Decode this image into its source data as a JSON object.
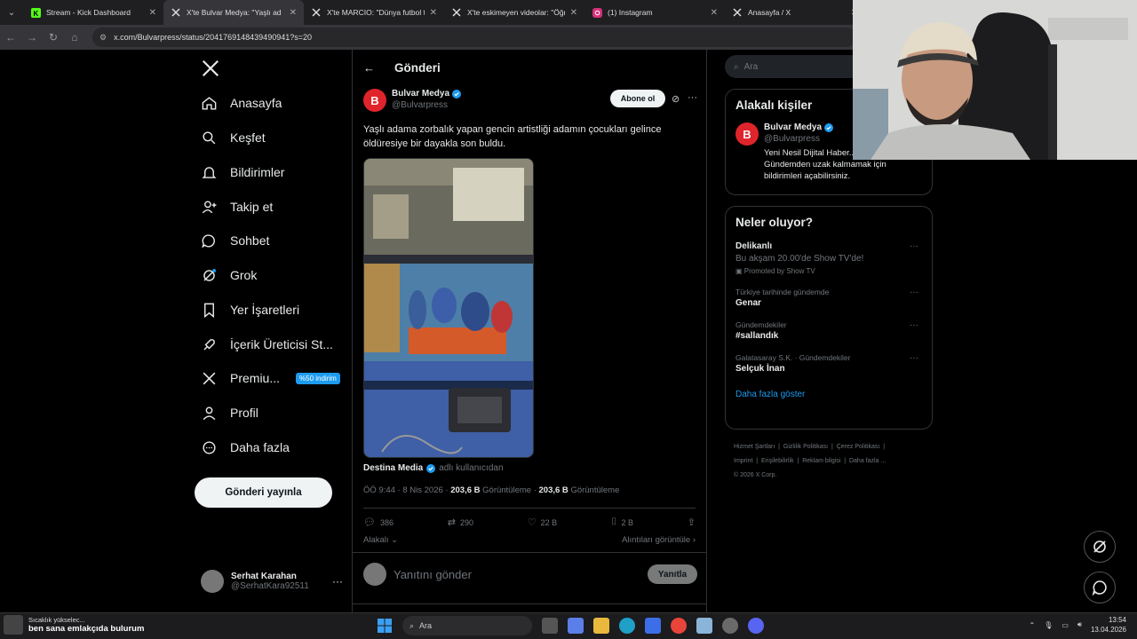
{
  "browser": {
    "tabs": [
      {
        "title": "Stream - Kick Dashboard",
        "icon": "kick-icon",
        "active": false
      },
      {
        "title": "X'te Bulvar Medya: \"Yaşlı ad",
        "icon": "x-icon",
        "active": true
      },
      {
        "title": "X'te MARCIO: \"Dünya futbol ta",
        "icon": "x-icon",
        "active": false
      },
      {
        "title": "X'te eskimeyen videolar: \"Öğre",
        "icon": "x-icon",
        "active": false
      },
      {
        "title": "(1) Instagram",
        "icon": "instagram-icon",
        "active": false
      },
      {
        "title": "Anasayfa / X",
        "icon": "x-icon",
        "active": false
      }
    ],
    "url": "x.com/Bulvarpress/status/2041769148439490941?s=20"
  },
  "left_nav": {
    "items": [
      {
        "label": "Anasayfa",
        "icon": "home-icon"
      },
      {
        "label": "Keşfet",
        "icon": "search-icon"
      },
      {
        "label": "Bildirimler",
        "icon": "bell-icon"
      },
      {
        "label": "Takip et",
        "icon": "follow-icon"
      },
      {
        "label": "Sohbet",
        "icon": "chat-icon"
      },
      {
        "label": "Grok",
        "icon": "grok-icon"
      },
      {
        "label": "Yer İşaretleri",
        "icon": "bookmark-icon"
      },
      {
        "label": "İçerik Üreticisi St...",
        "icon": "rocket-icon"
      },
      {
        "label": "Premiu...",
        "icon": "x-logo-icon"
      },
      {
        "label": "Profil",
        "icon": "profile-icon"
      },
      {
        "label": "Daha fazla",
        "icon": "more-circle-icon"
      }
    ],
    "premium_badge": "%50 indirim",
    "post_button": "Gönderi yayınla",
    "account": {
      "name": "Serhat Karahan",
      "handle": "@SerhatKara92511"
    }
  },
  "post": {
    "header": "Gönderi",
    "author_name": "Bulvar Medya",
    "author_handle": "@Bulvarpress",
    "subscribe": "Abone ol",
    "text": "Yaşlı adama zorbalık yapan gencin artistliği adamın çocukları gelince öldüresiye bir dayakla son buldu.",
    "credit_name": "Destina Media",
    "credit_suffix": "adlı kullanıcıdan",
    "time": "ÖÖ 9:44 · 8 Nis 2026 ·",
    "views1": "203,6 B",
    "views1_label": "Görüntüleme ·",
    "views2": "203,6 B",
    "views2_label": "Görüntüleme",
    "replies": "386",
    "reposts": "290",
    "likes": "22 B",
    "bookmarks": "2 B",
    "related": "Alakalı",
    "quotes": "Alıntıları görüntüle",
    "reply_placeholder": "Yanıtını gönder",
    "reply_button": "Yanıtla"
  },
  "right": {
    "search_placeholder": "Ara",
    "people_title": "Alakalı kişiler",
    "person_name": "Bulvar Medya",
    "person_handle": "@Bulvarpress",
    "person_bio": "Yeni Nesil Dijital Haber... | Gündemden uzak kalmamak için bildirimleri açabilirsiniz.",
    "trends_title": "Neler oluyor?",
    "trends": [
      {
        "category": "",
        "name": "Delikanlı",
        "desc": "Bu akşam 20.00'de Show TV'de!",
        "promo": "Promoted by Show TV"
      },
      {
        "category": "Türkiye tarihinde gündemde",
        "name": "Genar"
      },
      {
        "category": "Gündemdekiler",
        "name": "#sallandık"
      },
      {
        "category": "Galatasaray S.K. · Gündemdekiler",
        "name": "Selçuk İnan"
      }
    ],
    "show_more": "Daha fazla göster",
    "footer_links": [
      "Hizmet Şartları",
      "Gizlilik Politikası",
      "Çerez Politikası",
      "Imprint",
      "Erişilebilirlik",
      "Reklam bilgisi",
      "Daha fazla ..."
    ],
    "copyright": "© 2026 X Corp."
  },
  "taskbar": {
    "notif_line1": "Sıcaklık yükselec...",
    "notif_line2": "ben sana emlakçıda bulurum",
    "search": "Ara",
    "time": "13:54",
    "date": "13.04.2026"
  }
}
